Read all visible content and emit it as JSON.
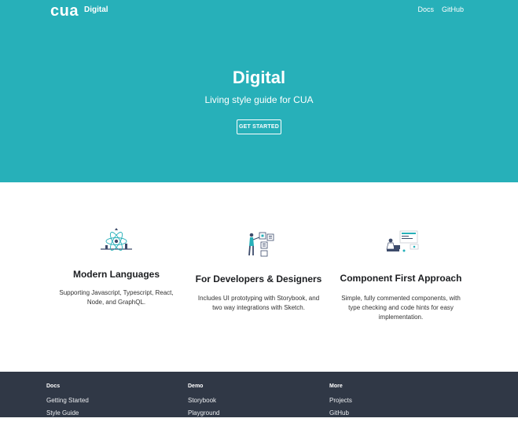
{
  "nav": {
    "logo": "cua",
    "brand": "Digital",
    "links": [
      "Docs",
      "GitHub"
    ]
  },
  "hero": {
    "title": "Digital",
    "subtitle": "Living style guide for CUA",
    "cta": "GET STARTED"
  },
  "features": [
    {
      "title": "Modern Languages",
      "desc_lines": [
        "Supporting Javascript, Typescript, React,",
        "Node, and GraphQL."
      ]
    },
    {
      "title": "For Developers & Designers",
      "desc_lines": [
        "Includes UI prototyping with Storybook, and",
        "two way integrations with Sketch."
      ]
    },
    {
      "title": "Component First Approach",
      "desc_lines": [
        "Simple, fully commented components, with",
        "type checking and code hints for easy",
        "implementation."
      ]
    }
  ],
  "footer": {
    "columns": [
      {
        "heading": "Docs",
        "links": [
          "Getting Started",
          "Style Guide"
        ]
      },
      {
        "heading": "Demo",
        "links": [
          "Storybook",
          "Playground"
        ]
      },
      {
        "heading": "More",
        "links": [
          "Projects",
          "GitHub"
        ]
      }
    ]
  },
  "colors": {
    "hero": "#27b0b9",
    "footer": "#303846",
    "accent_dark": "#3d4b6b"
  }
}
